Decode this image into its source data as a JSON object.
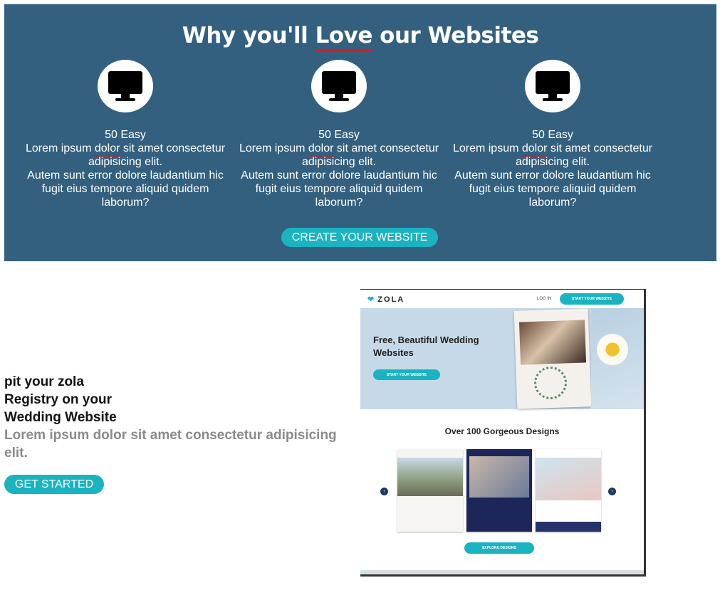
{
  "hero": {
    "title_before": "Why you'll ",
    "title_highlight": "Love",
    "title_after": " our Websites",
    "features": [
      {
        "heading": "50 Easy",
        "line1_before": "Lorem ipsum ",
        "line1_highlight": "dolor",
        "line1_after": " sit amet consectetur adipisicing elit.",
        "line2": "Autem sunt error dolore laudantium hic fugit eius tempore aliquid quidem laborum?",
        "icon": "monitor-icon"
      },
      {
        "heading": "50 Easy",
        "line1_before": "Lorem ipsum ",
        "line1_highlight": "dolor",
        "line1_after": " sit amet consectetur adipisicing elit.",
        "line2": "Autem sunt error dolore laudantium hic fugit eius tempore aliquid quidem laborum?",
        "icon": "monitor-icon"
      },
      {
        "heading": "50 Easy",
        "line1_before": "Lorem ipsum ",
        "line1_highlight": "dolor",
        "line1_after": " sit amet consectetur adipisicing elit.",
        "line2": "Autem sunt error dolore laudantium hic fugit eius tempore aliquid quidem laborum?",
        "icon": "monitor-icon"
      }
    ],
    "cta_label": "CREATE YOUR WEBSITE"
  },
  "promo": {
    "title_line1": "pit your zola",
    "title_line2": "Registry on your",
    "title_line3": "Wedding Website",
    "description": "Lorem ipsum dolor sit amet consectetur adipisicing elit.",
    "button_label": "GET STARTED"
  },
  "screenshot": {
    "logo": "ZOLA",
    "login": "LOG IN",
    "start_button": "START YOUR WEBSITE",
    "banner_title": "Free, Beautiful Wedding Websites",
    "banner_button": "START YOUR WEBSITE",
    "designs_title": "Over 100 Gorgeous Designs",
    "explore_button": "EXPLORE DESIGNS"
  },
  "colors": {
    "hero_bg": "#33607f",
    "accent": "#1bb3c0",
    "underline": "#c0232b"
  }
}
